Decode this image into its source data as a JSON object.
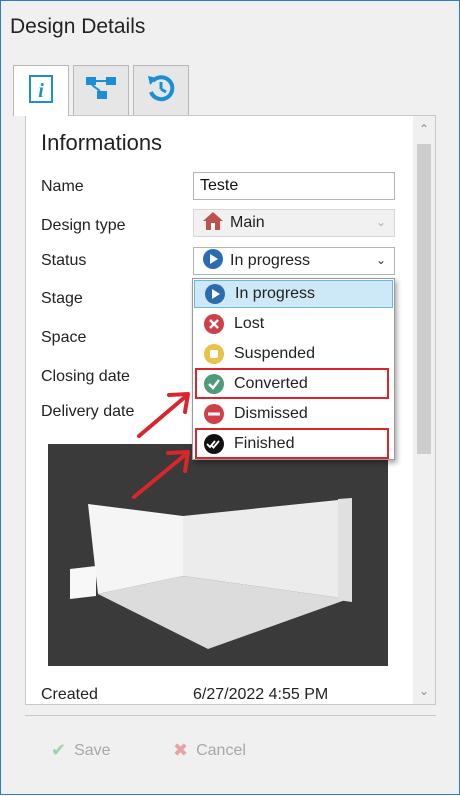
{
  "window": {
    "title": "Design Details"
  },
  "tabs": [
    {
      "name": "info-tab",
      "icon": "info-icon"
    },
    {
      "name": "hierarchy-tab",
      "icon": "hierarchy-icon"
    },
    {
      "name": "history-tab",
      "icon": "history-icon"
    }
  ],
  "section": {
    "title": "Informations"
  },
  "fields": {
    "name": {
      "label": "Name",
      "value": "Teste"
    },
    "design_type": {
      "label": "Design type",
      "value": "Main",
      "icon": "house-icon"
    },
    "status": {
      "label": "Status",
      "value": "In progress",
      "icon": "play-circle-icon"
    },
    "stage": {
      "label": "Stage"
    },
    "space": {
      "label": "Space"
    },
    "closing_date": {
      "label": "Closing date"
    },
    "delivery_date": {
      "label": "Delivery date"
    },
    "created": {
      "label": "Created",
      "value": "6/27/2022 4:55 PM"
    }
  },
  "status_dropdown": {
    "options": [
      {
        "label": "In progress",
        "icon": "play-circle-icon",
        "color": "#2b6cb0",
        "selected": true
      },
      {
        "label": "Lost",
        "icon": "x-circle-icon",
        "color": "#d0404a"
      },
      {
        "label": "Suspended",
        "icon": "pause-circle-icon",
        "color": "#e8c24a"
      },
      {
        "label": "Converted",
        "icon": "check-circle-icon",
        "color": "#4f9a78",
        "highlighted": true
      },
      {
        "label": "Dismissed",
        "icon": "minus-circle-icon",
        "color": "#d0404a"
      },
      {
        "label": "Finished",
        "icon": "double-check-circle-icon",
        "color": "#111111",
        "highlighted": true
      }
    ]
  },
  "footer": {
    "save_label": "Save",
    "cancel_label": "Cancel"
  },
  "colors": {
    "accent": "#2b6cb0",
    "annotation_red": "#d9262d",
    "tab_icon_blue": "#1a8fd6"
  }
}
